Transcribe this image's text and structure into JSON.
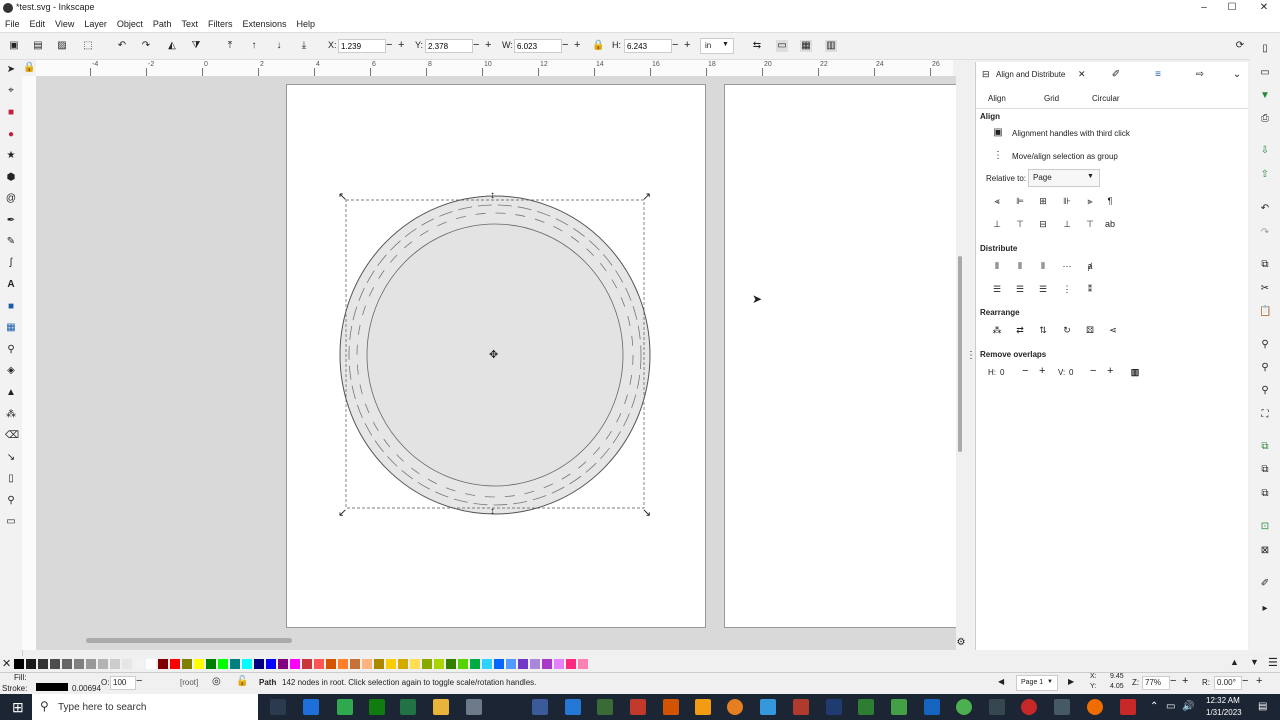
{
  "window": {
    "title": "*test.svg - Inkscape",
    "minimize": "–",
    "maximize": "☐",
    "close": "✕"
  },
  "menu": [
    "File",
    "Edit",
    "View",
    "Layer",
    "Object",
    "Path",
    "Text",
    "Filters",
    "Extensions",
    "Help"
  ],
  "toolbar": {
    "x_label": "X:",
    "x_value": "1.239",
    "y_label": "Y:",
    "y_value": "2.378",
    "w_label": "W:",
    "w_value": "6.023",
    "h_label": "H:",
    "h_value": "6.243",
    "units": "in"
  },
  "ruler": [
    "-4",
    "-2",
    "0",
    "2",
    "4",
    "6",
    "8",
    "10",
    "12",
    "14",
    "16",
    "18",
    "20",
    "22",
    "24",
    "26"
  ],
  "panel": {
    "tab_title": "Align and Distribute",
    "subtabs": [
      "Align",
      "Grid",
      "Circular"
    ],
    "align_header": "Align",
    "opt_third_click": "Alignment handles with third click",
    "opt_group": "Move/align selection as group",
    "relative_label": "Relative to:",
    "relative_value": "Page",
    "distribute_header": "Distribute",
    "rearrange_header": "Rearrange",
    "overlap_header": "Remove overlaps",
    "h_label": "H:",
    "h_value": "0",
    "v_label": "V:",
    "v_value": "0"
  },
  "status": {
    "fill_label": "Fill:",
    "stroke_label": "Stroke:",
    "stroke_width": "0.00694",
    "opacity_label": "O:",
    "opacity_value": "100",
    "layer": "[root]",
    "message_bold": "Path",
    "message": "142 nodes in root. Click selection again to toggle scale/rotation handles.",
    "page_value": "Page 1",
    "cursor_x_label": "X:",
    "cursor_x": "9.45",
    "cursor_y_label": "Y:",
    "cursor_y": "4.05",
    "zoom_label": "Z:",
    "zoom": "77%",
    "rotate_label": "R:",
    "rotate": "0.00°"
  },
  "taskbar": {
    "search_placeholder": "Type here to search",
    "time": "12:32 AM",
    "date": "1/31/2023"
  },
  "palette_colors": [
    "#000000",
    "#1a1a1a",
    "#333333",
    "#4d4d4d",
    "#666666",
    "#808080",
    "#999999",
    "#b3b3b3",
    "#cccccc",
    "#e6e6e6",
    "#f2f2f2",
    "#ffffff",
    "#800000",
    "#ff0000",
    "#808000",
    "#ffff00",
    "#008000",
    "#00ff00",
    "#008080",
    "#00ffff",
    "#000080",
    "#0000ff",
    "#800080",
    "#ff00ff",
    "#c83737",
    "#ff5555",
    "#d45500",
    "#ff7f2a",
    "#c87137",
    "#ffb380",
    "#aa8800",
    "#ffcc00",
    "#d4aa00",
    "#ffdd55",
    "#88aa00",
    "#aad400",
    "#338000",
    "#55d400",
    "#00aa44",
    "#2ad4ff",
    "#0066ff",
    "#5599ff",
    "#7137c8",
    "#aa87de",
    "#ab37c8",
    "#e580ff",
    "#ff2a7f",
    "#ff80b2"
  ]
}
